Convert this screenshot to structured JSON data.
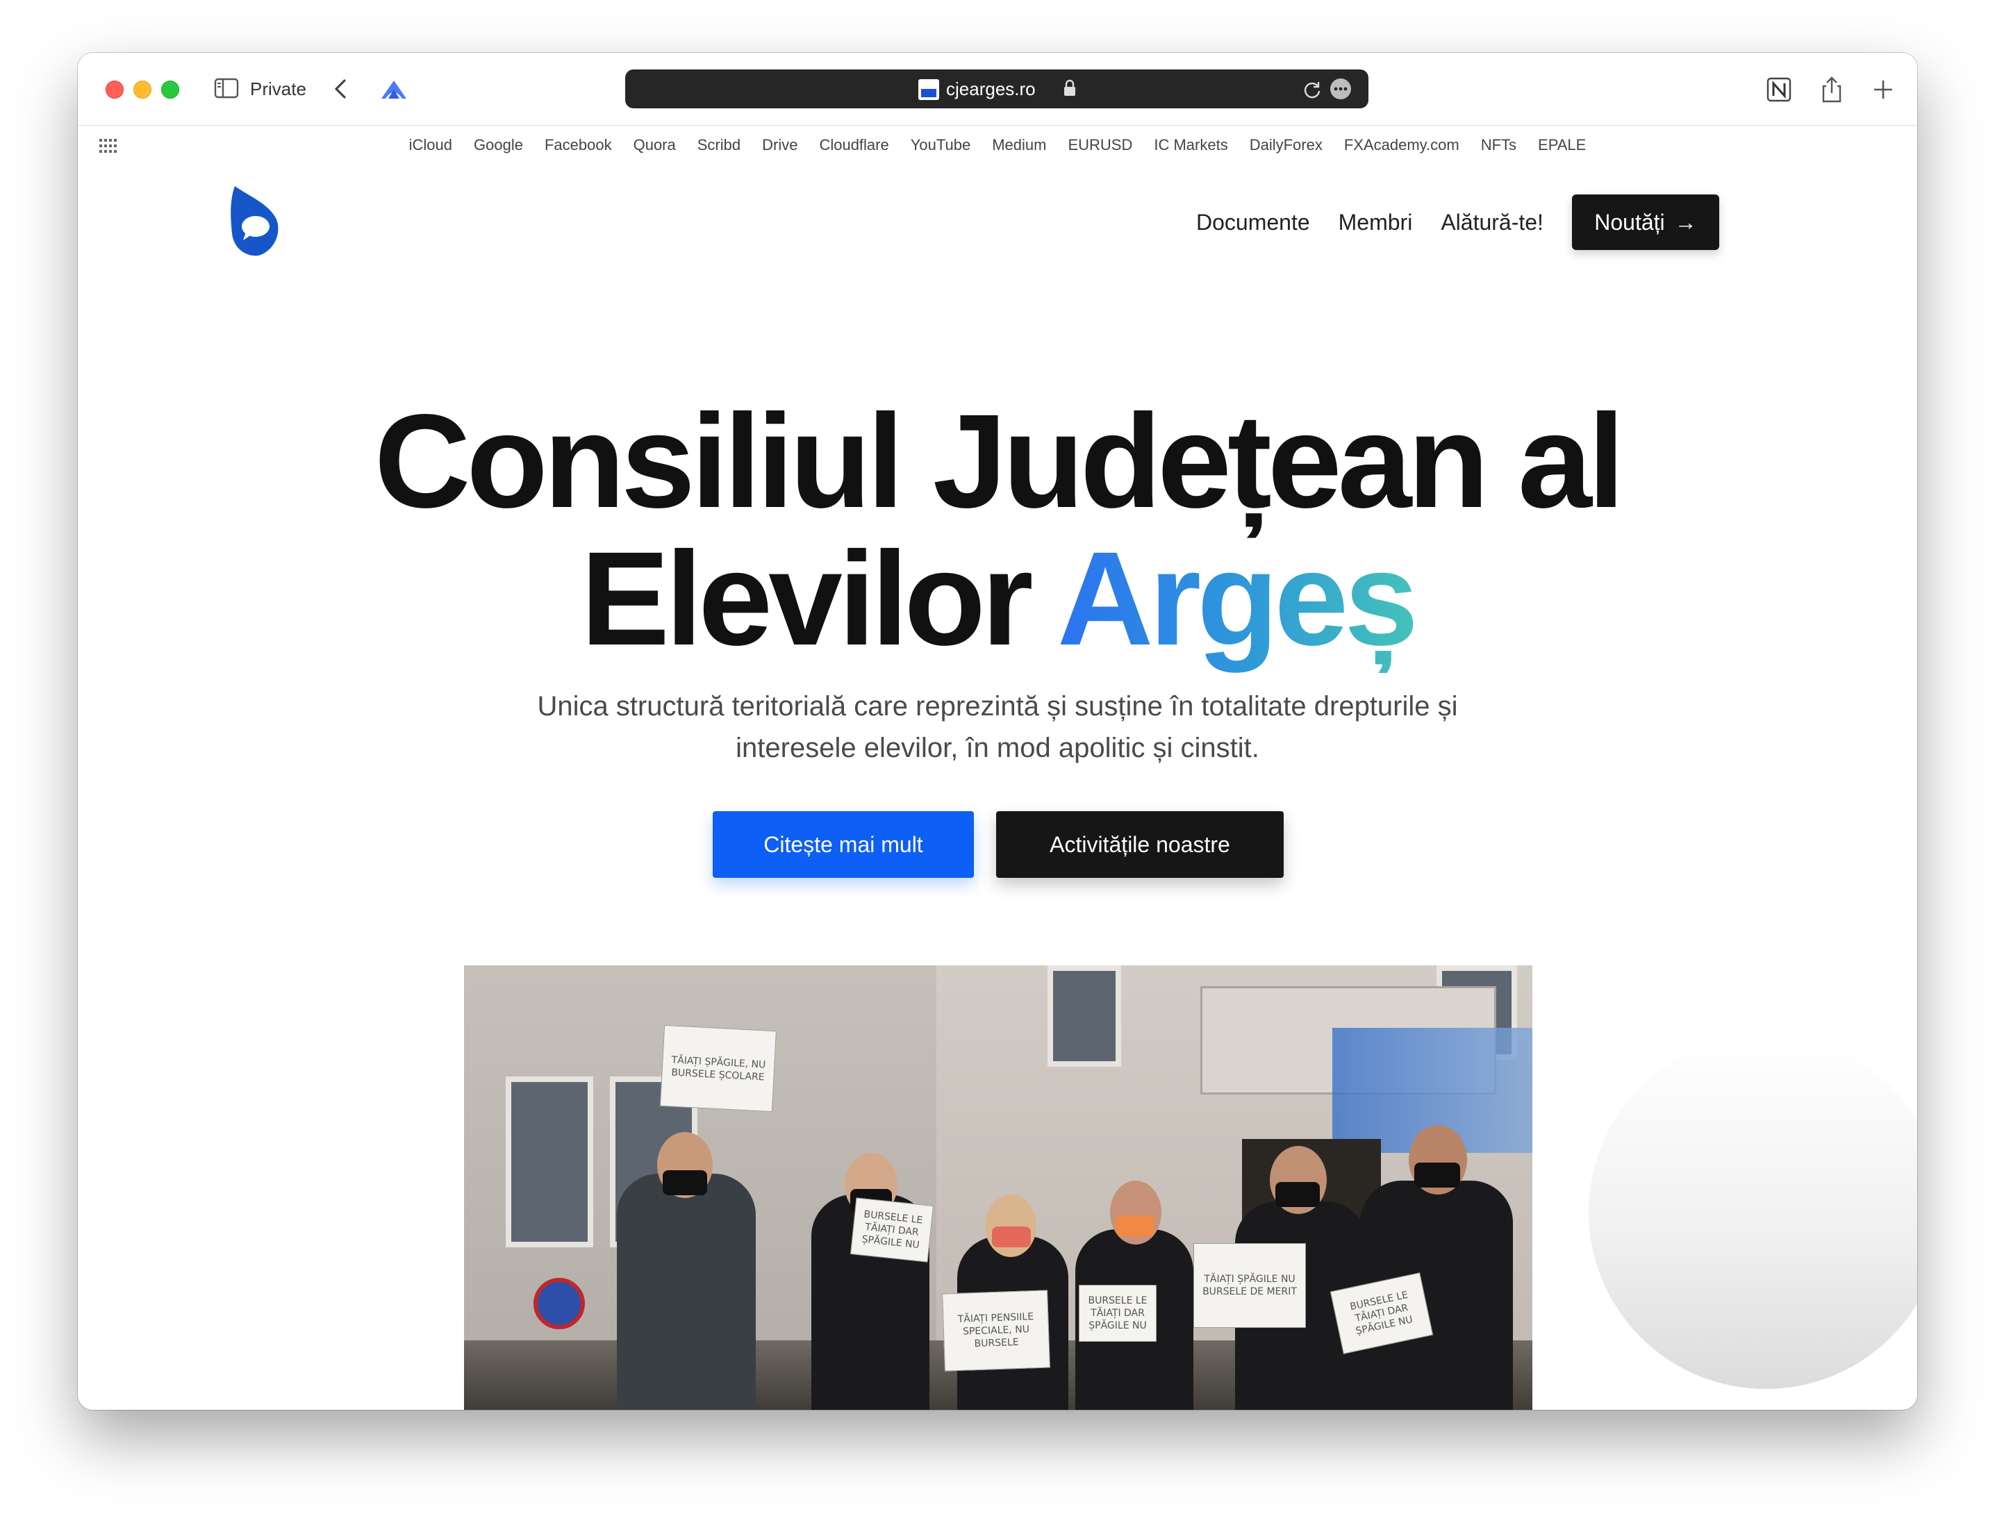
{
  "browser": {
    "private_label": "Private",
    "url": "cjearges.ro",
    "favorites": [
      "iCloud",
      "Google",
      "Facebook",
      "Quora",
      "Scribd",
      "Drive",
      "Cloudflare",
      "YouTube",
      "Medium",
      "EURUSD",
      "IC Markets",
      "DailyForex",
      "FXAcademy.com",
      "NFTs",
      "EPALE"
    ]
  },
  "site": {
    "nav": {
      "documente": "Documente",
      "membri": "Membri",
      "alatura": "Alătură-te!",
      "noutati": "Noutăți",
      "noutati_arrow": "→"
    },
    "hero": {
      "title_line1": "Consiliul Județean al",
      "title_line2_plain": "Elevilor ",
      "title_line2_accent": "Argeș",
      "subtitle": "Unica structură teritorială care reprezintă și susține în totalitate drepturile și interesele elevilor, în mod apolitic și cinstit.",
      "btn_primary": "Citește mai mult",
      "btn_secondary": "Activitățile noastre"
    },
    "photo_signs": {
      "sign1": "TĂIAȚI ȘPĂGILE, NU BURSELE ȘCOLARE",
      "sign2": "BURSELE LE TĂIAȚI DAR ȘPĂGILE NU",
      "sign3": "TĂIAȚI PENSIILE SPECIALE, NU BURSELE",
      "sign4": "BURSELE LE TĂIAȚI DAR ȘPĂGILE NU",
      "sign5": "TĂIAȚI ȘPĂGILE NU BURSELE DE MERIT",
      "sign6": "BURSELE LE TĂIAȚI DAR ȘPĂGILE NU"
    }
  },
  "colors": {
    "primary_button": "#0d5ff5",
    "dark_button": "#161616",
    "gradient_start": "#2b73f0",
    "gradient_end": "#45c2b9",
    "logo_blue": "#1656c9"
  }
}
